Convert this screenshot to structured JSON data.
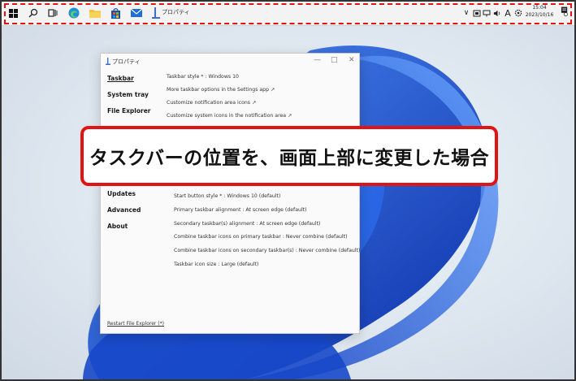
{
  "taskbar": {
    "apps": [
      {
        "name": "start-icon"
      },
      {
        "name": "search-icon"
      },
      {
        "name": "task-view-icon"
      },
      {
        "name": "edge-icon"
      },
      {
        "name": "file-explorer-icon"
      },
      {
        "name": "store-icon"
      },
      {
        "name": "mail-icon"
      },
      {
        "name": "properties-app-icon"
      }
    ],
    "active_app_label": "プロパティ",
    "tray": {
      "chevron": "∨",
      "ime": "A",
      "time": "15:04",
      "date": "2023/10/16"
    }
  },
  "window": {
    "title": "プロパティ",
    "controls": {
      "minimize": "—",
      "maximize": "□",
      "close": "✕"
    },
    "nav": [
      {
        "label": "Taskbar"
      },
      {
        "label": "System tray"
      },
      {
        "label": "File Explorer"
      },
      {
        "label": "Updates"
      },
      {
        "label": "Advanced"
      },
      {
        "label": "About"
      }
    ],
    "settings_top": [
      "Taskbar style * : Windows 10",
      "More taskbar options in the Settings app ↗",
      "Customize notification area icons ↗",
      "Customize system icons in the notification area ↗"
    ],
    "settings_bottom": [
      "Start button style * : Windows 10 (default)",
      "Primary taskbar alignment : At screen edge (default)",
      "Secondary taskbar(s) alignment : At screen edge (default)",
      "Combine taskbar icons on primary taskbar : Never combine (default)",
      "Combine taskbar icons on secondary taskbar(s) : Never combine (default)",
      "Taskbar icon size : Large (default)"
    ],
    "restart_link": "Restart File Explorer (*)"
  },
  "callout": {
    "text": "タスクバーの位置を、画面上部に変更した場合"
  },
  "colors": {
    "highlight": "#e01414",
    "wallpaper_blue": "#1a5ad8"
  }
}
